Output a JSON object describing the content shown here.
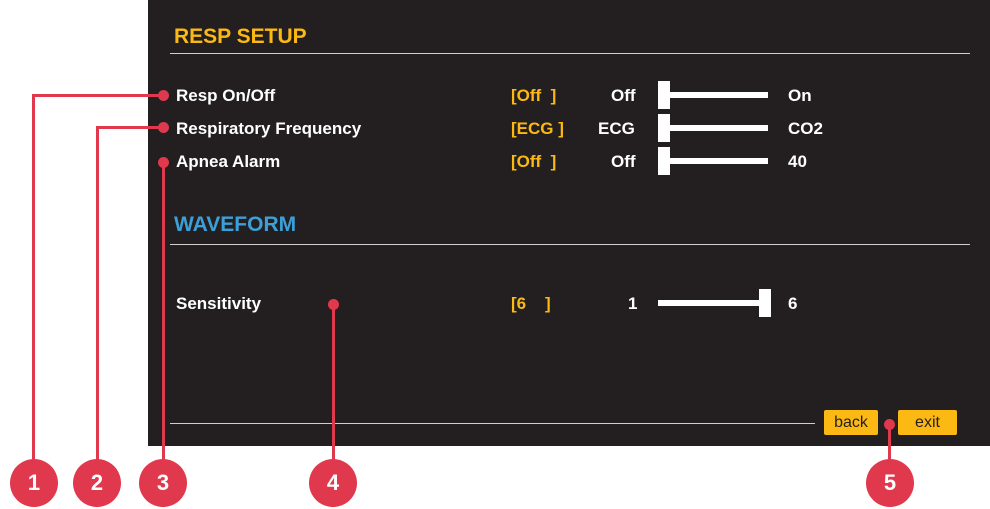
{
  "resp_setup": {
    "title": "RESP SETUP",
    "rows": [
      {
        "label": "Resp On/Off",
        "bracket": "[Off  ]",
        "min": "Off",
        "max": "On",
        "value": "Off"
      },
      {
        "label": "Respiratory Frequency",
        "bracket": "[ECG ]",
        "min": "ECG",
        "max": "CO2",
        "value": "ECG"
      },
      {
        "label": "Apnea Alarm",
        "bracket": "[Off  ]",
        "min": "Off",
        "max": "40",
        "value": "Off"
      }
    ]
  },
  "waveform": {
    "title": "WAVEFORM",
    "rows": [
      {
        "label": "Sensitivity",
        "bracket": "[6    ]",
        "min": "1",
        "max": "6",
        "value": "6"
      }
    ]
  },
  "footer": {
    "back_label": "back",
    "exit_label": "exit"
  },
  "callouts": [
    "1",
    "2",
    "3",
    "4",
    "5"
  ],
  "colors": {
    "panel_bg": "#231f20",
    "accent_yellow": "#fdb913",
    "accent_blue": "#3ca0d8",
    "callout_red": "#e0384c",
    "text_white": "#ffffff"
  }
}
